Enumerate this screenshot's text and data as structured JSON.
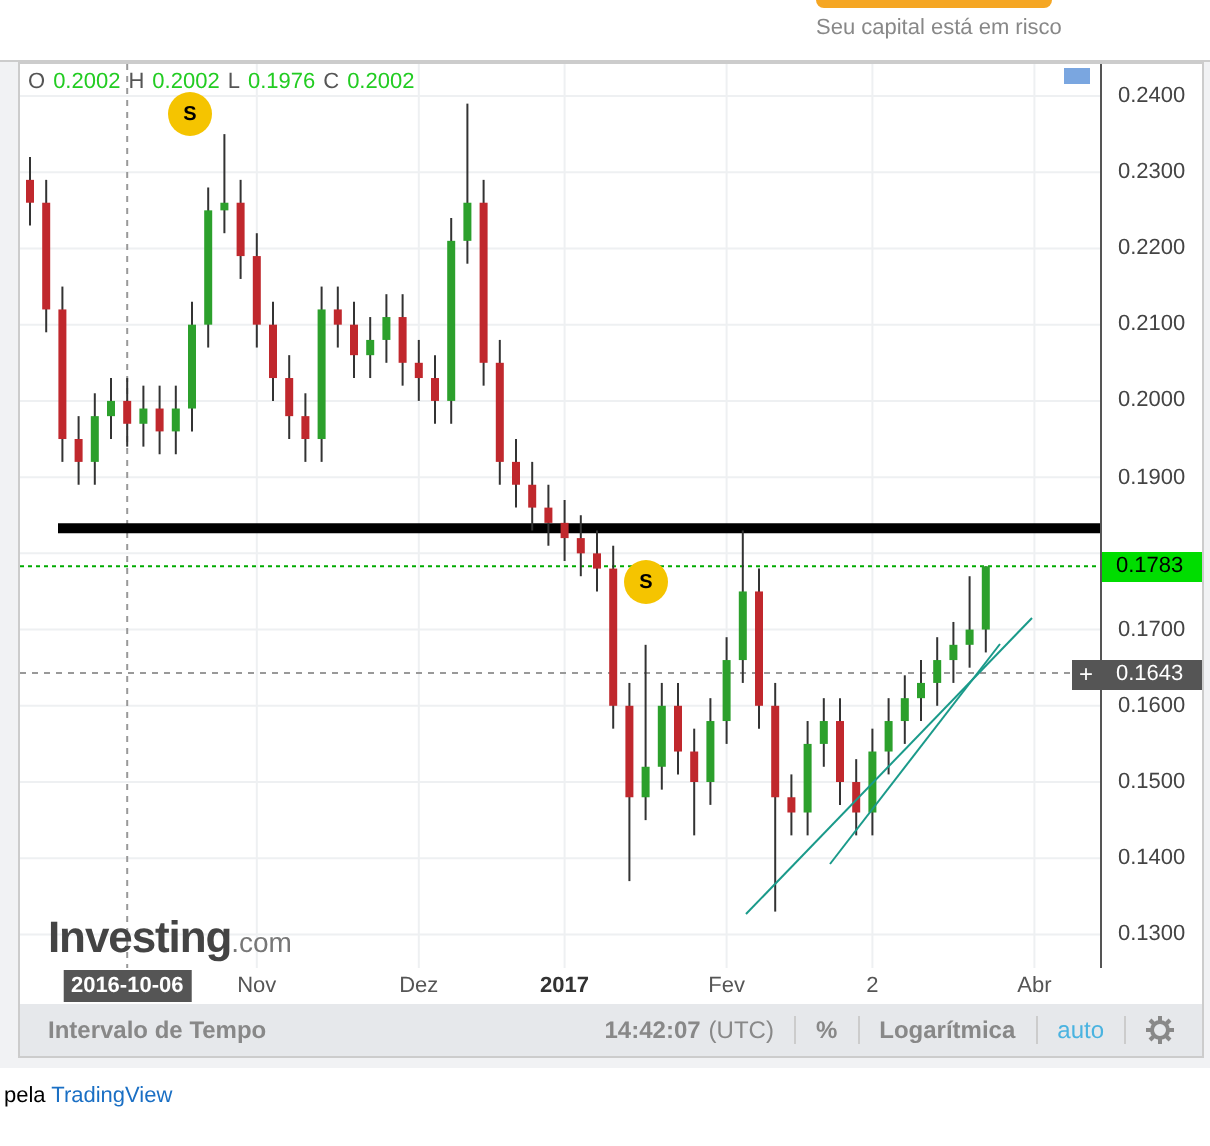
{
  "header": {
    "risk_note": "Seu capital está em risco"
  },
  "chart": {
    "ohlc": [
      {
        "label": "O",
        "value": "0.2002"
      },
      {
        "label": "H",
        "value": "0.2002"
      },
      {
        "label": "L",
        "value": "0.1976"
      },
      {
        "label": "C",
        "value": "0.2002"
      }
    ],
    "chart_data": {
      "type": "candlestick",
      "categories": [
        null,
        null,
        null,
        null,
        null,
        null,
        "2016-10-06",
        null,
        null,
        null,
        null,
        null,
        null,
        null,
        "Nov",
        null,
        null,
        null,
        null,
        null,
        null,
        null,
        null,
        null,
        "Dez",
        null,
        null,
        null,
        null,
        null,
        null,
        null,
        null,
        "2017",
        null,
        null,
        null,
        null,
        null,
        null,
        null,
        null,
        null,
        "Fev",
        null,
        null,
        null,
        null,
        null,
        null,
        null,
        null,
        "2",
        null,
        null,
        null,
        null,
        null,
        null,
        null,
        null,
        null,
        "Abr"
      ],
      "ylim": [
        0.1256,
        0.2442
      ],
      "grid": true,
      "ref_lines": [
        {
          "axis": "y",
          "value": 0.1833,
          "color": "#000000"
        },
        {
          "axis": "y",
          "value": 0.1783,
          "color": "#00aa00"
        },
        {
          "axis": "y",
          "value": 0.1643,
          "color": "#999999"
        }
      ],
      "yticks": [
        {
          "value": 0.24,
          "label": "0.2400"
        },
        {
          "value": 0.23,
          "label": "0.2300"
        },
        {
          "value": 0.22,
          "label": "0.2200"
        },
        {
          "value": 0.21,
          "label": "0.2100"
        },
        {
          "value": 0.2,
          "label": "0.2000"
        },
        {
          "value": 0.19,
          "label": "0.1900"
        },
        {
          "value": 0.17,
          "label": "0.1700"
        },
        {
          "value": 0.16,
          "label": "0.1600"
        },
        {
          "value": 0.15,
          "label": "0.1500"
        },
        {
          "value": 0.14,
          "label": "0.1400"
        },
        {
          "value": 0.13,
          "label": "0.1300"
        }
      ],
      "ohlc": [
        [
          0.229,
          0.232,
          0.223,
          0.226
        ],
        [
          0.226,
          0.229,
          0.209,
          0.212
        ],
        [
          0.212,
          0.215,
          0.192,
          0.195
        ],
        [
          0.195,
          0.198,
          0.189,
          0.192
        ],
        [
          0.192,
          0.201,
          0.189,
          0.198
        ],
        [
          0.198,
          0.203,
          0.195,
          0.2
        ],
        [
          0.2,
          0.203,
          0.194,
          0.197
        ],
        [
          0.197,
          0.202,
          0.194,
          0.199
        ],
        [
          0.199,
          0.202,
          0.193,
          0.196
        ],
        [
          0.196,
          0.202,
          0.193,
          0.199
        ],
        [
          0.199,
          0.213,
          0.196,
          0.21
        ],
        [
          0.21,
          0.228,
          0.207,
          0.225
        ],
        [
          0.225,
          0.235,
          0.222,
          0.226
        ],
        [
          0.226,
          0.229,
          0.216,
          0.219
        ],
        [
          0.219,
          0.222,
          0.207,
          0.21
        ],
        [
          0.21,
          0.213,
          0.2,
          0.203
        ],
        [
          0.203,
          0.206,
          0.195,
          0.198
        ],
        [
          0.198,
          0.201,
          0.192,
          0.195
        ],
        [
          0.195,
          0.215,
          0.192,
          0.212
        ],
        [
          0.212,
          0.215,
          0.207,
          0.21
        ],
        [
          0.21,
          0.213,
          0.203,
          0.206
        ],
        [
          0.206,
          0.211,
          0.203,
          0.208
        ],
        [
          0.208,
          0.214,
          0.205,
          0.211
        ],
        [
          0.211,
          0.214,
          0.202,
          0.205
        ],
        [
          0.205,
          0.208,
          0.2,
          0.203
        ],
        [
          0.203,
          0.206,
          0.197,
          0.2
        ],
        [
          0.2,
          0.224,
          0.197,
          0.221
        ],
        [
          0.221,
          0.239,
          0.218,
          0.226
        ],
        [
          0.226,
          0.229,
          0.202,
          0.205
        ],
        [
          0.205,
          0.208,
          0.189,
          0.192
        ],
        [
          0.192,
          0.195,
          0.186,
          0.189
        ],
        [
          0.189,
          0.192,
          0.183,
          0.186
        ],
        [
          0.186,
          0.189,
          0.181,
          0.184
        ],
        [
          0.184,
          0.187,
          0.179,
          0.182
        ],
        [
          0.182,
          0.185,
          0.177,
          0.18
        ],
        [
          0.18,
          0.183,
          0.175,
          0.178
        ],
        [
          0.178,
          0.181,
          0.157,
          0.16
        ],
        [
          0.16,
          0.163,
          0.137,
          0.148
        ],
        [
          0.148,
          0.168,
          0.145,
          0.152
        ],
        [
          0.152,
          0.163,
          0.149,
          0.16
        ],
        [
          0.16,
          0.163,
          0.151,
          0.154
        ],
        [
          0.154,
          0.157,
          0.143,
          0.15
        ],
        [
          0.15,
          0.161,
          0.147,
          0.158
        ],
        [
          0.158,
          0.169,
          0.155,
          0.166
        ],
        [
          0.166,
          0.183,
          0.163,
          0.175
        ],
        [
          0.175,
          0.178,
          0.157,
          0.16
        ],
        [
          0.16,
          0.163,
          0.133,
          0.148
        ],
        [
          0.148,
          0.151,
          0.143,
          0.146
        ],
        [
          0.146,
          0.158,
          0.143,
          0.155
        ],
        [
          0.155,
          0.161,
          0.152,
          0.158
        ],
        [
          0.158,
          0.161,
          0.147,
          0.15
        ],
        [
          0.15,
          0.153,
          0.143,
          0.146
        ],
        [
          0.146,
          0.157,
          0.143,
          0.154
        ],
        [
          0.154,
          0.161,
          0.151,
          0.158
        ],
        [
          0.158,
          0.164,
          0.155,
          0.161
        ],
        [
          0.161,
          0.166,
          0.158,
          0.163
        ],
        [
          0.163,
          0.169,
          0.16,
          0.166
        ],
        [
          0.166,
          0.171,
          0.163,
          0.168
        ],
        [
          0.168,
          0.177,
          0.165,
          0.17
        ],
        [
          0.17,
          0.1783,
          0.167,
          0.1783
        ],
        null,
        null,
        null
      ]
    },
    "time_label_states": [
      {
        "highlighted": true,
        "bold": true
      },
      {
        "highlighted": false,
        "bold": false
      },
      {
        "highlighted": false,
        "bold": false
      },
      {
        "highlighted": false,
        "bold": true
      },
      {
        "highlighted": false,
        "bold": false
      },
      {
        "highlighted": false,
        "bold": false
      },
      {
        "highlighted": false,
        "bold": false
      }
    ],
    "markers": [
      {
        "text": "S"
      },
      {
        "text": "S"
      }
    ],
    "logo": {
      "name": "Investing",
      "suffix": ".com"
    },
    "last_price": "0.1783",
    "cursor_price": {
      "button": "+",
      "value": "0.1643"
    }
  },
  "toolbar": {
    "interval": "Intervalo de Tempo",
    "time": "14:42:07",
    "timezone": "(UTC)",
    "percent": "%",
    "log": "Logarítmica",
    "auto": "auto"
  },
  "footer": {
    "prefix": "pela",
    "link": "TradingView"
  }
}
